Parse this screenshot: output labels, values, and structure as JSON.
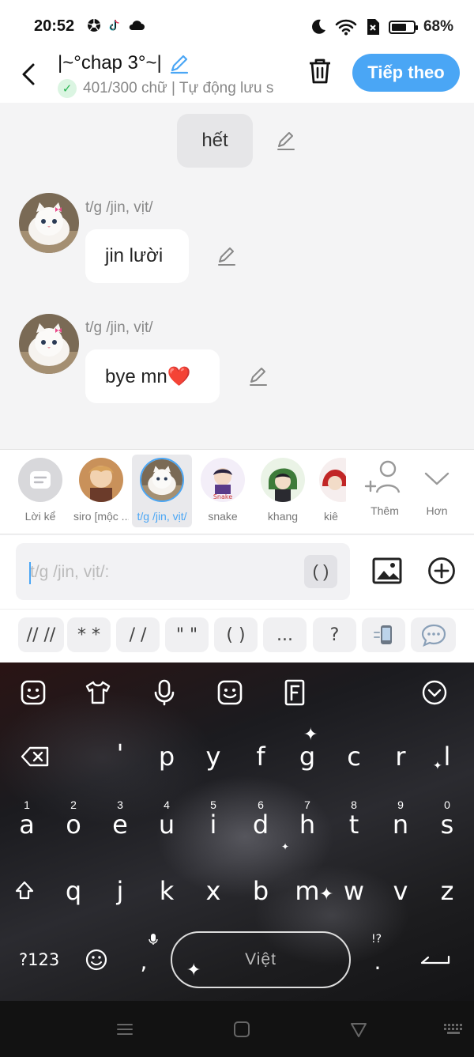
{
  "status": {
    "time": "20:52",
    "battery": "68%",
    "battery_level": 0.68,
    "left_icons": [
      "soccer-icon",
      "tiktok-icon",
      "cloud-icon"
    ],
    "right_icons": [
      "moon-icon",
      "wifi-icon",
      "sim-off-icon",
      "battery-icon"
    ]
  },
  "header": {
    "title": "|~°chap 3°~|",
    "subtitle": "401/300 chữ | Tự động lưu s",
    "next_label": "Tiếp theo",
    "accent": "#4aa6f5"
  },
  "chat": {
    "narration": "hết",
    "messages": [
      {
        "sender": "t/g /jin, vịt/",
        "text": "jin lười"
      },
      {
        "sender": "t/g /jin, vịt/",
        "text": "bye mn❤️"
      }
    ]
  },
  "characters": {
    "items": [
      {
        "label": "Lời kể",
        "kind": "narrator"
      },
      {
        "label": "siro [mộc ...",
        "kind": "avatar"
      },
      {
        "label": "t/g /jin, vịt/",
        "kind": "avatar",
        "selected": true
      },
      {
        "label": "snake",
        "kind": "avatar"
      },
      {
        "label": "khang",
        "kind": "avatar"
      },
      {
        "label": "kiê",
        "kind": "avatar"
      }
    ],
    "add_label": "Thêm",
    "more_label": "Hơn"
  },
  "input": {
    "placeholder": "t/g /jin, vịt/:",
    "paren_button": "( )"
  },
  "quick_symbols": [
    "// //",
    "* *",
    "/ /",
    "\" \"",
    "( )",
    "...",
    "?"
  ],
  "keyboard": {
    "row1": [
      "'",
      "p",
      "y",
      "f",
      "g",
      "c",
      "r",
      "l"
    ],
    "row2": [
      "a",
      "o",
      "e",
      "u",
      "i",
      "d",
      "h",
      "t",
      "n",
      "s"
    ],
    "row2_numbers": [
      "1",
      "2",
      "3",
      "4",
      "5",
      "6",
      "7",
      "8",
      "9",
      "0"
    ],
    "row3": [
      "q",
      "j",
      "k",
      "x",
      "b",
      "m",
      "w",
      "v",
      "z"
    ],
    "symbols_label": "?123",
    "comma": ",",
    "space_label": "Việt",
    "period": ".",
    "period_hint": "!?"
  }
}
